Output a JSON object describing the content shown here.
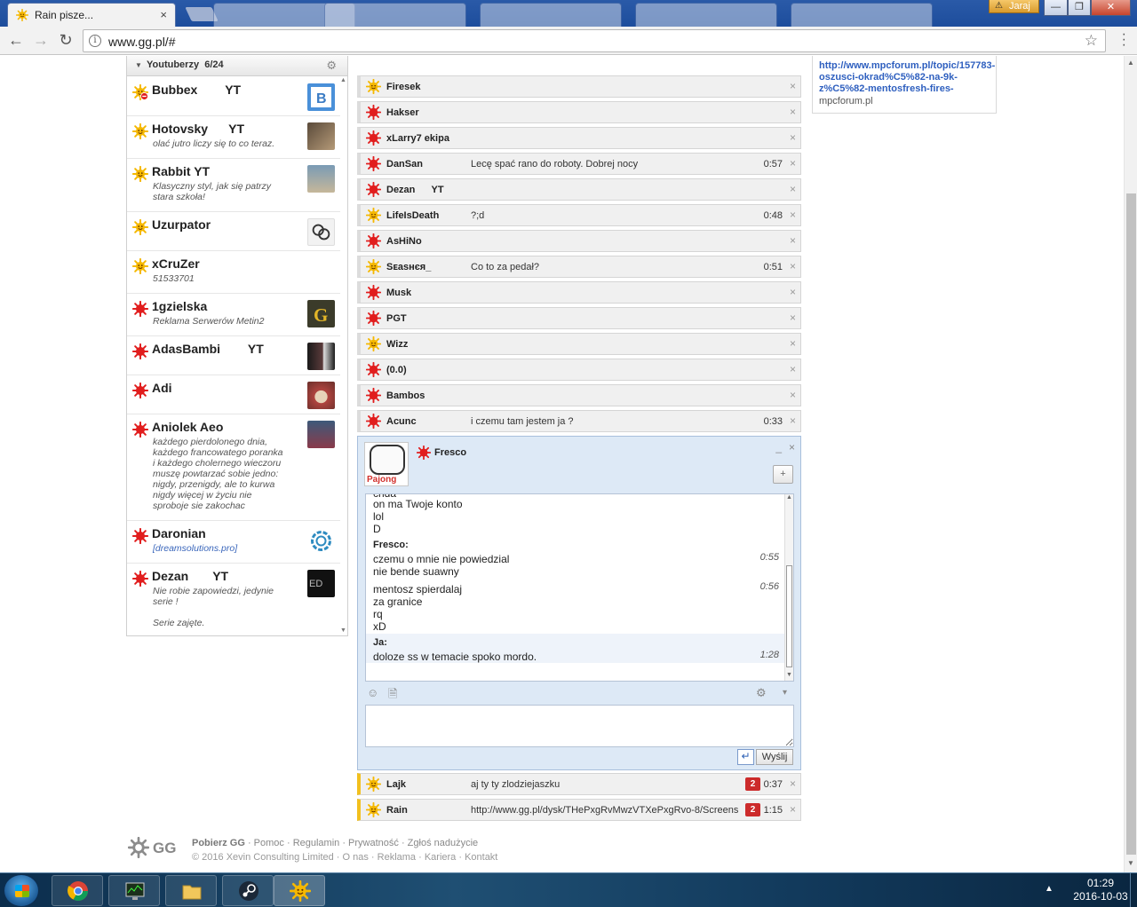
{
  "browser": {
    "active_tab": "Rain pisze...",
    "background_tabs": [
      "",
      "",
      "",
      "",
      "",
      ""
    ],
    "url": "www.gg.pl/#",
    "user_badge": "Jaraj",
    "window_buttons": [
      "—",
      "❐",
      "✕"
    ]
  },
  "contacts": {
    "group_name": "Youtuberzy",
    "group_count": "6/24",
    "items": [
      {
        "name": "Bubbex        YT",
        "desc": "",
        "status": "busy",
        "avatar": "#4a90d9"
      },
      {
        "name": "Hotovsky      YT",
        "desc": "olać jutro liczy się to co teraz.",
        "status": "available",
        "avatar": "#5a4a3a"
      },
      {
        "name": "Rabbit YT",
        "desc": "Klasyczny styl, jak się patrzy\nstara szkoła!",
        "status": "available",
        "avatar": "#7a9bb5"
      },
      {
        "name": "Uzurpator",
        "desc": "",
        "status": "available",
        "avatar": "#eeeeee"
      },
      {
        "name": "xCruZer",
        "desc": "51533701",
        "status": "available",
        "avatar": ""
      },
      {
        "name": "1gzielska",
        "desc": "Reklama Serwerów Metin2",
        "status": "offline",
        "avatar": "#c9a227"
      },
      {
        "name": "AdasBambi        YT",
        "desc": "",
        "status": "offline",
        "avatar": "#3a2a2a"
      },
      {
        "name": "Adi",
        "desc": "",
        "status": "offline",
        "avatar": "#b0443f"
      },
      {
        "name": "Aniolek Aeo",
        "desc": "każdego pierdolonego dnia,\nkażdego francowatego poranka\ni każdego cholernego wieczoru\nmuszę powtarzać sobie jedno:\nnigdy, przenigdy, ale to kurwa\nnigdy więcej w życiu nie\nsproboje sie zakochac",
        "status": "offline",
        "avatar": "#3d5a7a"
      },
      {
        "name": "Daronian",
        "desc": "[dreamsolutions.pro]",
        "status": "offline",
        "avatar": "#2e8bc0",
        "desc_is_link": true
      },
      {
        "name": "Dezan       YT",
        "desc": "Nie robie zapowiedzi, jedynie\nserie !\n\nSerie zajęte.",
        "status": "offline",
        "avatar": "#111111"
      }
    ]
  },
  "conversations": [
    {
      "name": "Firesek",
      "msg": "",
      "time": "",
      "status": "available"
    },
    {
      "name": "Hakser",
      "msg": "",
      "time": "",
      "status": "offline"
    },
    {
      "name": "xLarry7 ekipa",
      "msg": "",
      "time": "",
      "status": "offline"
    },
    {
      "name": "DanSan",
      "msg": "Lecę spać rano do roboty. Dobrej nocy",
      "time": "0:57",
      "status": "offline"
    },
    {
      "name": "Dezan      YT",
      "msg": "",
      "time": "",
      "status": "offline"
    },
    {
      "name": "LifeIsDeath",
      "msg": "?;d",
      "time": "0:48",
      "status": "available"
    },
    {
      "name": "AsHiNo",
      "msg": "",
      "time": "",
      "status": "offline"
    },
    {
      "name": "Sᴇasнєя_",
      "msg": "Co to za pedał?",
      "time": "0:51",
      "status": "available"
    },
    {
      "name": "Musk",
      "msg": "",
      "time": "",
      "status": "offline"
    },
    {
      "name": "PGT",
      "msg": "",
      "time": "",
      "status": "offline"
    },
    {
      "name": "Wizz",
      "msg": "",
      "time": "",
      "status": "available"
    },
    {
      "name": "(0.0)",
      "msg": "",
      "time": "",
      "status": "offline"
    },
    {
      "name": "Bambos",
      "msg": "",
      "time": "",
      "status": "offline"
    },
    {
      "name": "Acunc",
      "msg": "i czemu tam jestem ja ?",
      "time": "0:33",
      "status": "offline"
    }
  ],
  "chat": {
    "name": "Fresco",
    "avatar_label": "Pajong",
    "minimize": "_",
    "close": "×",
    "add_contact": "+",
    "messages": {
      "cut_line": "chda",
      "block1": [
        "on ma Twoje konto",
        "lol",
        "D"
      ],
      "sender2": "Fresco:",
      "line2a": "czemu o mnie nie powiedzial",
      "time2a": "0:55",
      "line2b": "nie bende suawny",
      "line3a": "mentosz spierdalaj",
      "time3a": "0:56",
      "block3": [
        "za granice",
        "rq",
        "xD"
      ],
      "sender_me": "Ja:",
      "line_me": "doloze ss w temacie spoko mordo.",
      "time_me": "1:28"
    },
    "input_value": "",
    "send_label": "Wyślij",
    "enter_symbol": "↵"
  },
  "unread_conversations": [
    {
      "name": "Lajk",
      "msg": "aj ty ty zlodziejaszku",
      "count": "2",
      "time": "0:37",
      "status": "available"
    },
    {
      "name": "Rain",
      "msg": "http://www.gg.pl/dysk/THePxgRvMwzVTXePxgRvo-8/Screens",
      "count": "2",
      "time": "1:15",
      "status": "available"
    }
  ],
  "preview": {
    "link_lines": "http://www.mpcforum.pl/topic/157783-\noszusci-okrad%C5%82-na-9k-\nz%C5%82-mentosfresh-fires-",
    "domain": "mpcforum.pl"
  },
  "footer": {
    "logo": "GG",
    "links_primary": "Pobierz GG",
    "links_rest": " · Pomoc · Regulamin · Prywatność · Zgłoś nadużycie",
    "copyright": "© 2016 Xevin Consulting Limited · O nas · Reklama · Kariera · Kontakt"
  },
  "taskbar": {
    "time": "01:29",
    "date": "2016-10-03",
    "apps": [
      "chrome",
      "monitor",
      "explorer",
      "steam",
      "gg"
    ]
  },
  "colors": {
    "available_sun": "#f5b800",
    "offline_sun": "#e11d1d",
    "busy_badge": "#e11d1d",
    "unread_accent": "#f2c01e",
    "badge_red": "#cc2b2b"
  }
}
